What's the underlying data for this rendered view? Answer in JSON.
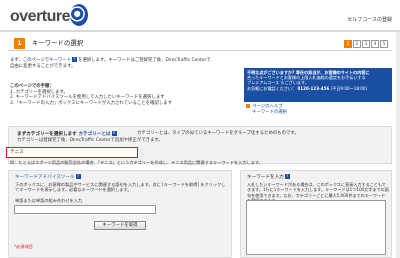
{
  "header": {
    "logo_text": "overture",
    "title": "セルフコースの登録"
  },
  "page": {
    "step_number": "1",
    "title": "キーワードの選択",
    "steps": [
      "1",
      "2",
      "3",
      "4",
      "5"
    ],
    "active_step": "1"
  },
  "intro": {
    "line1_pre": "まず、このページで",
    "line1_link": "キーワード",
    "line1_post": "を選択します。キーワードはご登録完了後、DirecTraffic Centerで",
    "line2": "自由に変更することができます。"
  },
  "howto": {
    "heading": "このページでの手順：",
    "items": [
      "1. カテゴリーを選択します。",
      "2. キーワードアドバイスツールを使用して入力したいキーワードを選択します",
      "3.「キーワードの入力」ボックスにキーワードが入力されていることを確認します"
    ]
  },
  "help_box": {
    "line1": "不明な点がございますか? 専任の担当が、お客様のサイトの内容に",
    "line2": "合ったキーワードとお客様の上限入札価格の選定をお手伝いする",
    "line3": "プレミアムコース もございます。",
    "line4": "お気軽にお電話ください：",
    "phone": "0120-123-456",
    "line5": "(平日9:00〜18:00)"
  },
  "help_link": {
    "label": "ページのヘルプ",
    "sub": "キーワードの選択"
  },
  "category": {
    "title": "まずカテゴリーを選択します",
    "link": "カテゴリーとは",
    "desc": "カテゴリーとは、タイプの似ているキーワードをグループ化するためのものです。",
    "desc2": "カテゴリーは登録完了後、DirecTraffic Centerで追加や修正ができます。",
    "input_value": "テニス",
    "example": "例：たとえばスポーツ用品の販売会社の場合、「テニス」というカテゴリーを作成し、テニス用品に関連するキーワードを入力します。"
  },
  "keyword_tool": {
    "title": "キーワードアドバイスツール",
    "desc": "下のボックスに、お客様の製品やサービスに関連する語句を入力します。次に [キーワードを取得] をクリックしてキーワードを表示します。必要なキーワードを選択します。",
    "input_label": "単語または単語の組み合わせを入力",
    "button_label": "キーワードを取得",
    "required_note": "*必須項目"
  },
  "keyword_entry": {
    "title": "キーワードを入力",
    "desc": "入札したいキーワードがある場合は、このボックスに直接入力することもできます。1行に1キーワードを入力します。キーワードは1つ100文字までの語句を使用できます。なお、カテゴリーごとに最大5,000件までのキーワードを登録できます。"
  },
  "colors": {
    "brand_blue": "#1b4fa3",
    "accent_orange": "#f08000",
    "highlight_red": "#d6171f"
  }
}
